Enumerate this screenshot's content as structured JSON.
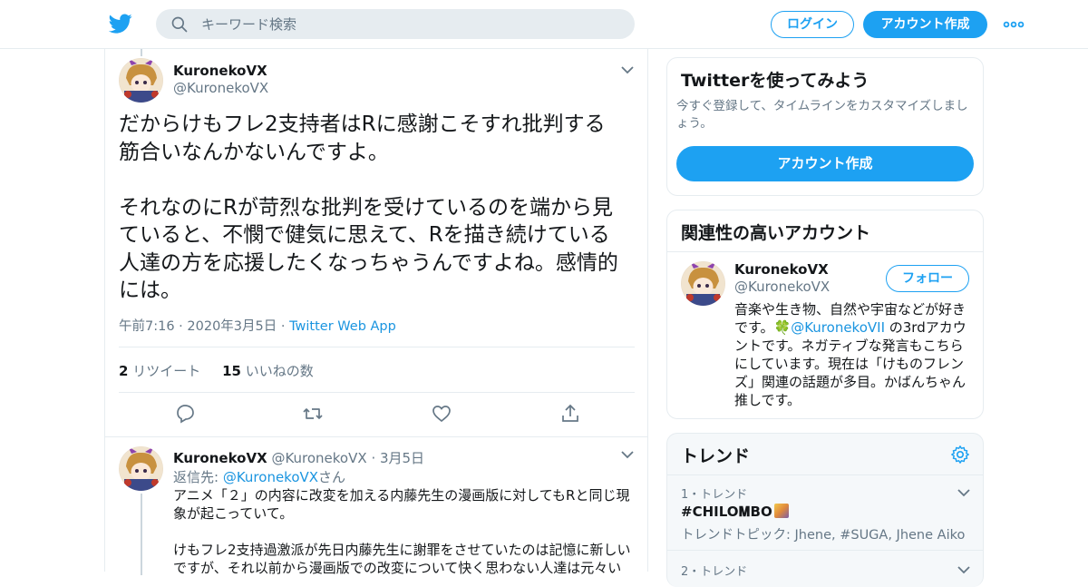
{
  "header": {
    "search_placeholder": "キーワード検索",
    "login_label": "ログイン",
    "signup_label": "アカウント作成"
  },
  "tweet": {
    "author_name": "KuronekoVX",
    "author_handle": "@KuronekoVX",
    "text": "だからけもフレ2支持者はRに感謝こそすれ批判する\n筋合いなんかないんですよ。\n\nそれなのにRが苛烈な批判を受けているのを端から見\nていると、不憫で健気に思えて、Rを描き続けている\n人達の方を応援したくなっちゃうんですよね。感情的\nには。",
    "timestamp": "午前7:16 · 2020年3月5日",
    "meta_sep": " · ",
    "source": "Twitter Web App",
    "retweet_count": "2",
    "retweet_label": "リツイート",
    "like_count": "15",
    "like_label": "いいねの数"
  },
  "reply": {
    "author_name": "KuronekoVX",
    "author_handle": "@KuronekoVX",
    "date": "· 3月5日",
    "reply_prefix": "返信先: ",
    "reply_to": "@KuronekoVX",
    "reply_suffix": "さん",
    "text": "アニメ「２」の内容に改変を加える内藤先生の漫画版に対してもRと同じ現\n象が起こっていて。\n\nけもフレ2支持過激派が先日内藤先生に謝罪をさせていたのは記憶に新しい\nですが、それ以前から漫画版での改変について快く思わない人達は元々い"
  },
  "signup_card": {
    "title": "Twitterを使ってみよう",
    "description": "今すぐ登録して、タイムラインをカスタマイズしましょう。",
    "button_label": "アカウント作成"
  },
  "related_card": {
    "title": "関連性の高いアカウント",
    "name": "KuronekoVX",
    "handle": "@KuronekoVX",
    "follow_label": "フォロー",
    "bio_before": "音楽や生き物、自然や宇宙などが好きです。",
    "bio_clover": "🍀",
    "bio_mention": "@KuronekoVII",
    "bio_after": " の3rdアカウントです。ネガティブな発言もこちらにしています。現在は「けものフレンズ」関連の話題が多目。かばんちゃん推しです。"
  },
  "trends_card": {
    "title": "トレンド",
    "items": [
      {
        "meta": "1・トレンド",
        "name": "#CHILO𝐌BO",
        "topic": "トレンドトピック: Jhene, #SUGA, Jhene Aiko"
      },
      {
        "meta": "2・トレンド"
      }
    ]
  },
  "colors": {
    "accent": "#1da1f2",
    "link": "#1b95e0",
    "secondary_text": "#657786",
    "border": "#e6ecf0"
  }
}
